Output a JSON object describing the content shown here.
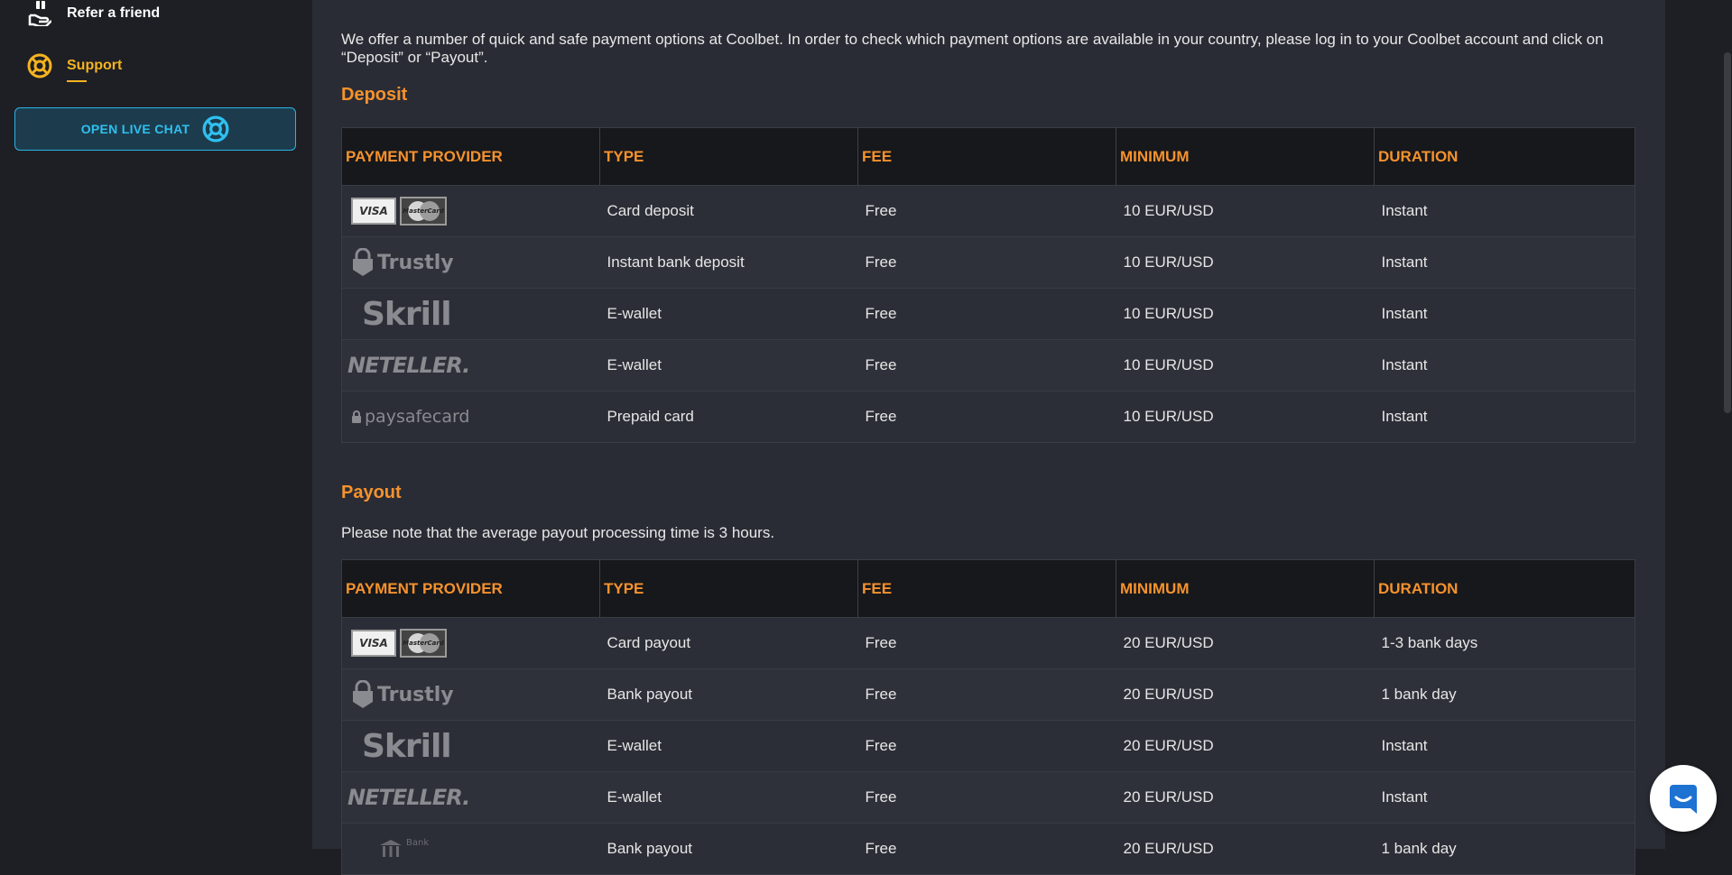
{
  "sidebar": {
    "refer_label": "Refer a friend",
    "support_label": "Support",
    "live_chat_label": "OPEN LIVE CHAT"
  },
  "intro": "We offer a number of quick and safe payment options at Coolbet. In order to check which payment options are available in your country, please log in to your Coolbet account and click on “Deposit” or “Payout”.",
  "deposit": {
    "title": "Deposit",
    "headers": [
      "PAYMENT PROVIDER",
      "TYPE",
      "FEE",
      "MINIMUM",
      "DURATION"
    ],
    "rows": [
      {
        "provider": "visa-mastercard",
        "type": "Card deposit",
        "fee": "Free",
        "minimum": "10 EUR/USD",
        "duration": "Instant"
      },
      {
        "provider": "trustly",
        "type": "Instant bank deposit",
        "fee": "Free",
        "minimum": "10 EUR/USD",
        "duration": "Instant"
      },
      {
        "provider": "skrill",
        "type": "E-wallet",
        "fee": "Free",
        "minimum": "10 EUR/USD",
        "duration": "Instant"
      },
      {
        "provider": "neteller",
        "type": "E-wallet",
        "fee": "Free",
        "minimum": "10 EUR/USD",
        "duration": "Instant"
      },
      {
        "provider": "paysafecard",
        "type": "Prepaid card",
        "fee": "Free",
        "minimum": "10 EUR/USD",
        "duration": "Instant"
      }
    ]
  },
  "payout": {
    "title": "Payout",
    "note": "Please note that the average payout processing time is 3 hours.",
    "headers": [
      "PAYMENT PROVIDER",
      "TYPE",
      "FEE",
      "MINIMUM",
      "DURATION"
    ],
    "rows": [
      {
        "provider": "visa-mastercard",
        "type": "Card payout",
        "fee": "Free",
        "minimum": "20 EUR/USD",
        "duration": "1-3 bank days"
      },
      {
        "provider": "trustly",
        "type": "Bank payout",
        "fee": "Free",
        "minimum": "20 EUR/USD",
        "duration": "1 bank day"
      },
      {
        "provider": "skrill",
        "type": "E-wallet",
        "fee": "Free",
        "minimum": "20 EUR/USD",
        "duration": "Instant"
      },
      {
        "provider": "neteller",
        "type": "E-wallet",
        "fee": "Free",
        "minimum": "20 EUR/USD",
        "duration": "Instant"
      },
      {
        "provider": "bank",
        "type": "Bank payout",
        "fee": "Free",
        "minimum": "20 EUR/USD",
        "duration": "1 bank day"
      }
    ]
  },
  "logos": {
    "visa": "VISA",
    "mastercard": "MasterCard",
    "trustly": "Trustly",
    "skrill": "Skrill",
    "neteller": "NETELLER.",
    "paysafecard": "paysafecard",
    "bank": "Bank"
  },
  "colors": {
    "accent_orange": "#f6922d",
    "support_yellow": "#f4b320",
    "chat_blue": "#2fc0f0",
    "panel_bg": "#2a2c35",
    "header_bg": "#17181b"
  }
}
